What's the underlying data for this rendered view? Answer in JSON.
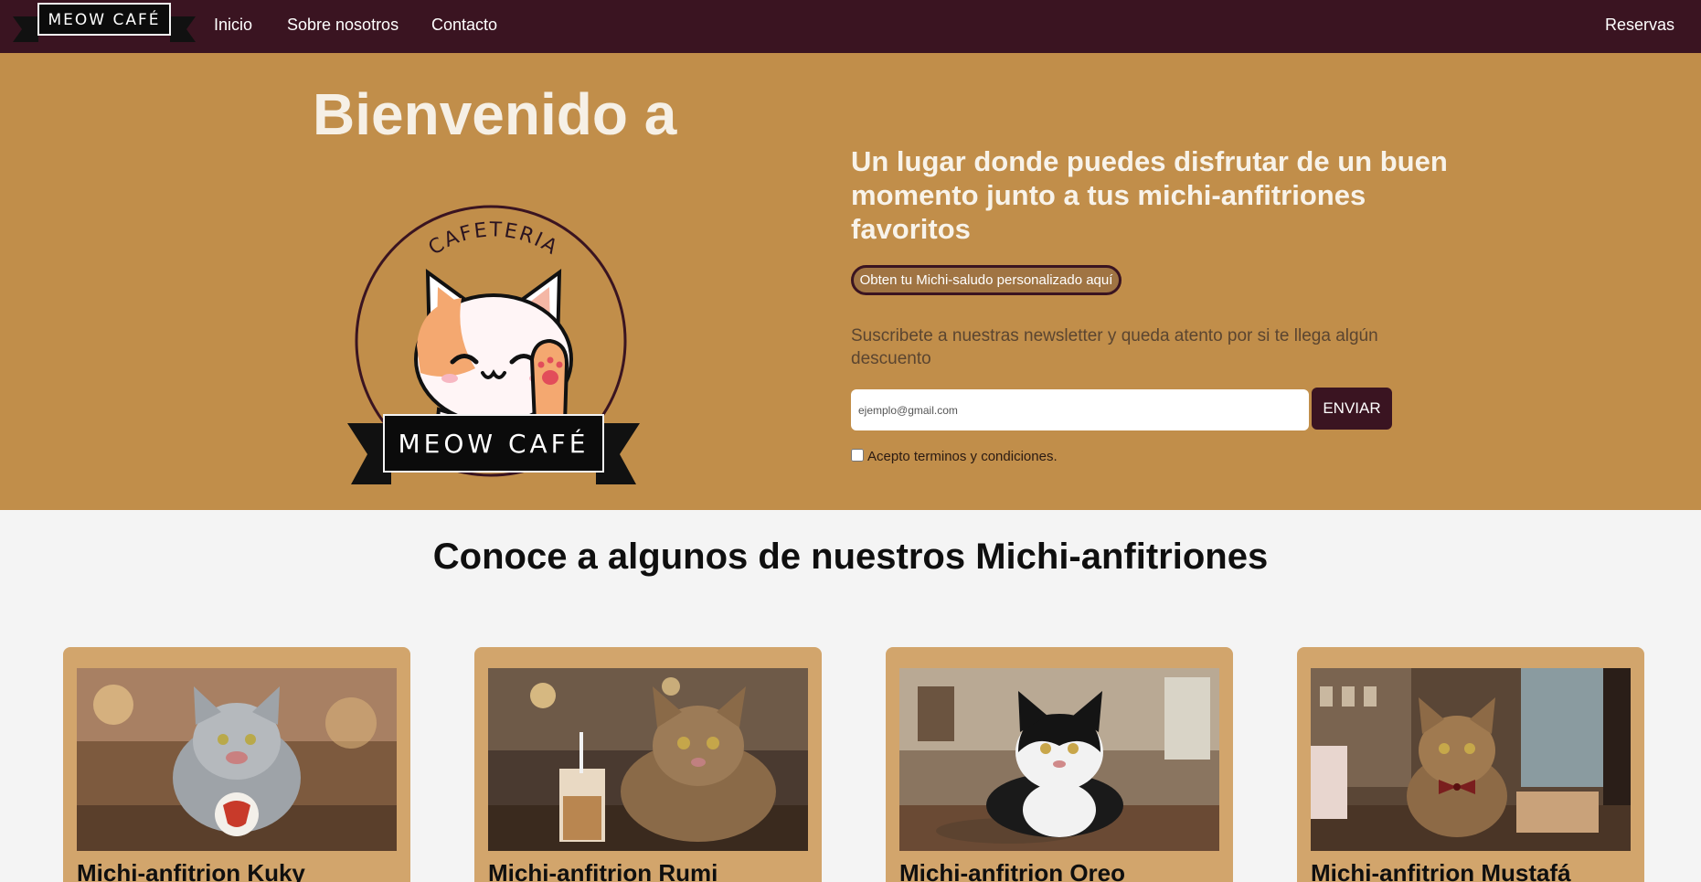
{
  "brand": {
    "logo_text": "MEOW CAFÉ"
  },
  "nav": {
    "items": [
      {
        "label": "Inicio"
      },
      {
        "label": "Sobre nosotros"
      },
      {
        "label": "Contacto"
      }
    ],
    "reservas_label": "Reservas"
  },
  "hero": {
    "title": "Bienvenido a",
    "logo_arc_text": "CAFETERIA",
    "logo_ribbon_text": "MEOW CAFÉ",
    "tagline": "Un lugar donde puedes disfrutar de un buen momento junto a tus michi-anfitriones favoritos",
    "greeting_button": "Obten tu Michi-saludo personalizado aquí",
    "newsletter_text": "Suscribete a nuestras newsletter y queda atento por si te llega algún descuento",
    "email_placeholder": "ejemplo@gmail.com",
    "send_button": "ENVIAR",
    "terms_label": "Acepto terminos y condiciones."
  },
  "hosts": {
    "title": "Conoce a algunos de nuestros Michi-anfitriones",
    "cards": [
      {
        "name": "Michi-anfitrion Kuky"
      },
      {
        "name": "Michi-anfitrion Rumi"
      },
      {
        "name": "Michi-anfitrion Oreo"
      },
      {
        "name": "Michi-anfitrion Mustafá"
      }
    ]
  },
  "colors": {
    "navbar": "#3a1421",
    "hero_bg": "#c18e4a",
    "card_bg": "#d2a56c",
    "page_bg": "#f4f4f4",
    "send_button": "#3a1421"
  }
}
